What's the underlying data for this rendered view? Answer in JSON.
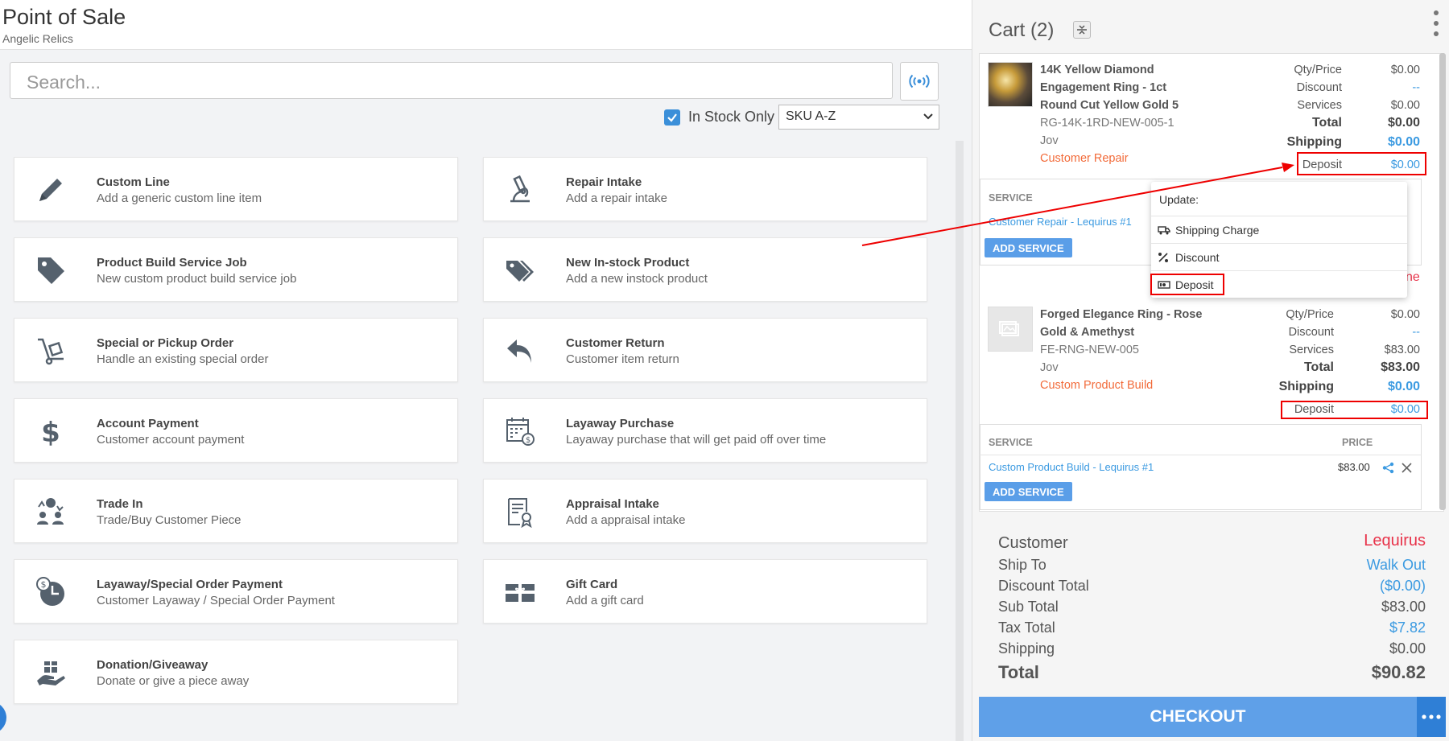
{
  "header": {
    "title": "Point of Sale",
    "subtitle": "Angelic Relics"
  },
  "search": {
    "placeholder": "Search..."
  },
  "filters": {
    "in_stock_label": "In Stock Only",
    "sort_value": "SKU A-Z"
  },
  "tiles": [
    {
      "title": "Custom Line",
      "desc": "Add a generic custom line item",
      "icon": "pencil-icon"
    },
    {
      "title": "Repair Intake",
      "desc": "Add a repair intake",
      "icon": "microscope-icon"
    },
    {
      "title": "Product Build Service Job",
      "desc": "New custom product build service job",
      "icon": "tag-icon"
    },
    {
      "title": "New In-stock Product",
      "desc": "Add a new instock product",
      "icon": "tags-icon"
    },
    {
      "title": "Special or Pickup Order",
      "desc": "Handle an existing special order",
      "icon": "dolly-icon"
    },
    {
      "title": "Customer Return",
      "desc": "Customer item return",
      "icon": "return-arrow-icon"
    },
    {
      "title": "Account Payment",
      "desc": "Customer account payment",
      "icon": "dollar-icon"
    },
    {
      "title": "Layaway Purchase",
      "desc": "Layaway purchase that will get paid off over time",
      "icon": "calendar-dollar-icon"
    },
    {
      "title": "Trade In",
      "desc": "Trade/Buy Customer Piece",
      "icon": "trade-icon"
    },
    {
      "title": "Appraisal Intake",
      "desc": "Add a appraisal intake",
      "icon": "certificate-icon"
    },
    {
      "title": "Layaway/Special Order Payment",
      "desc": "Customer Layaway / Special Order Payment",
      "icon": "clock-dollar-icon"
    },
    {
      "title": "Gift Card",
      "desc": "Add a gift card",
      "icon": "gift-card-icon"
    },
    {
      "title": "Donation/Giveaway",
      "desc": "Donate or give a piece away",
      "icon": "hand-gift-icon"
    }
  ],
  "cart": {
    "title": "Cart (2)",
    "item1": {
      "name_l1": "14K Yellow Diamond",
      "name_l2": "Engagement Ring - 1ct",
      "name_l3": "Round Cut Yellow Gold 5",
      "sku": "RG-14K-1RD-NEW-005-1",
      "salesperson": "Jov",
      "tag": "Customer Repair",
      "labels": {
        "qty": "Qty/Price",
        "discount": "Discount",
        "services": "Services",
        "total": "Total",
        "shipping": "Shipping",
        "deposit": "Deposit"
      },
      "values": {
        "qty": "$0.00",
        "discount": "--",
        "services": "$0.00",
        "total": "$0.00",
        "shipping": "$0.00",
        "deposit": "$0.00"
      },
      "service_header": "SERVICE",
      "service_link": "Customer Repair - Lequirus #1",
      "add_service": "ADD SERVICE",
      "partial_text": "ne"
    },
    "item2": {
      "name_l1": "Forged Elegance Ring - Rose",
      "name_l2": "Gold & Amethyst",
      "sku": "FE-RNG-NEW-005",
      "salesperson": "Jov",
      "tag": "Custom Product Build",
      "labels": {
        "qty": "Qty/Price",
        "discount": "Discount",
        "services": "Services",
        "total": "Total",
        "shipping": "Shipping",
        "deposit": "Deposit"
      },
      "values": {
        "qty": "$0.00",
        "discount": "--",
        "services": "$83.00",
        "total": "$83.00",
        "shipping": "$0.00",
        "deposit": "$0.00"
      },
      "service_header": "SERVICE",
      "price_header": "PRICE",
      "service_link": "Custom Product Build - Lequirus #1",
      "service_price": "$83.00",
      "add_service": "ADD SERVICE"
    }
  },
  "popup": {
    "header": "Update:",
    "items": [
      "Shipping Charge",
      "Discount",
      "Deposit"
    ]
  },
  "totals": {
    "customer_label": "Customer",
    "customer_value": "Lequirus",
    "ship_to_label": "Ship To",
    "ship_to_value": "Walk Out",
    "discount_label": "Discount Total",
    "discount_value": "($0.00)",
    "subtotal_label": "Sub Total",
    "subtotal_value": "$83.00",
    "tax_label": "Tax Total",
    "tax_value": "$7.82",
    "shipping_label": "Shipping",
    "shipping_value": "$0.00",
    "total_label": "Total",
    "total_value": "$90.82"
  },
  "checkout": {
    "label": "CHECKOUT"
  },
  "colors": {
    "accent_blue": "#3b9ae1",
    "tag_orange": "#f26b3a",
    "customer_red": "#e8334a",
    "annotation_red": "#e00000"
  }
}
